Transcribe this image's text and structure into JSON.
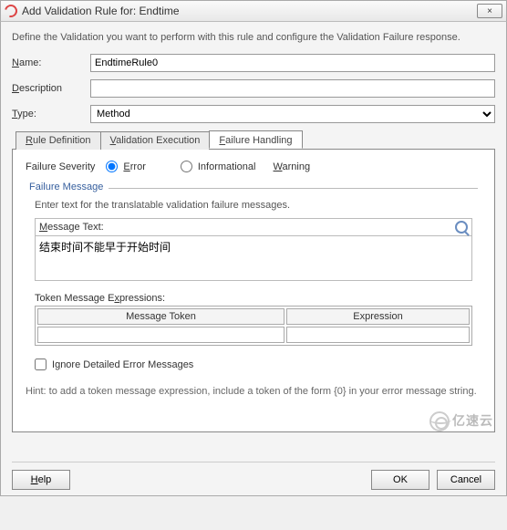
{
  "titlebar": {
    "title": "Add Validation Rule for: Endtime",
    "close": "×"
  },
  "intro": "Define the Validation you want to perform with this rule and configure the Validation Failure response.",
  "fields": {
    "name_label_pre": "N",
    "name_label_post": "ame:",
    "name_value": "EndtimeRule0",
    "desc_label_pre": "D",
    "desc_label_post": "escription",
    "desc_value": "",
    "type_label_pre": "T",
    "type_label_post": "ype:",
    "type_value": "Method"
  },
  "tabs": {
    "def_pre": "R",
    "def_post": "ule Definition",
    "exec_pre": "V",
    "exec_post": "alidation Execution",
    "fail_pre": "F",
    "fail_post": "ailure Handling"
  },
  "panel": {
    "severity_label": "Failure Severity",
    "error_pre": "E",
    "error_post": "rror",
    "warn_pre": "Informational ",
    "warn_u": "W",
    "warn_post": "arning",
    "failure_msg_label": "Failure Message",
    "enter_text_hint": "Enter text for the translatable validation failure messages.",
    "msg_text_pre": "M",
    "msg_text_post": "essage Text:",
    "msg_value": "结束时间不能早于开始时间",
    "token_label_pre": "Token Message E",
    "token_label_u": "x",
    "token_label_post": "pressions:",
    "col1": "Message Token",
    "col2": "Expression",
    "ignore_pre": "I",
    "ignore_u": "g",
    "ignore_post": "nore Detailed Error Messages",
    "hint2": "Hint: to add a token message expression, include a token of the form {0} in your error message string."
  },
  "buttons": {
    "help_u": "H",
    "help_post": "elp",
    "ok": "OK",
    "cancel": "Cancel"
  },
  "watermark": "亿速云"
}
